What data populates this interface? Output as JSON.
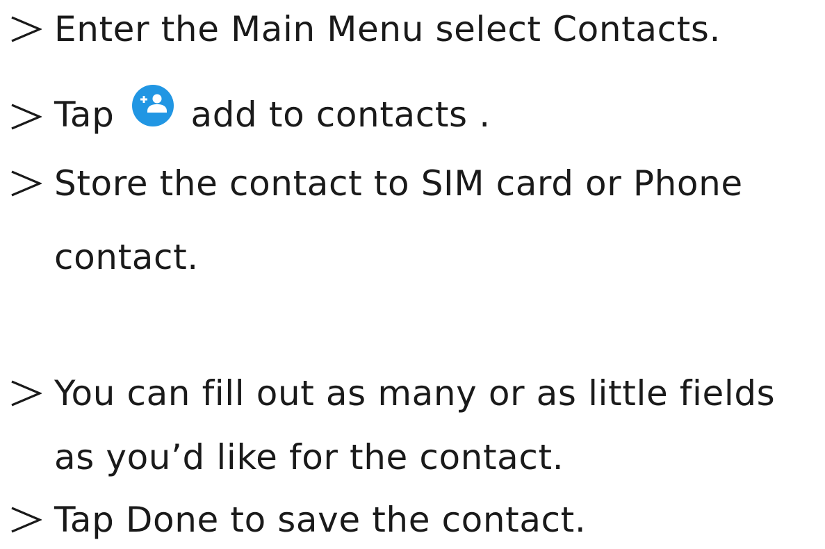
{
  "bullets": [
    {
      "text": "Enter the Main Menu select Contacts."
    },
    {
      "before": "Tap",
      "icon": "add-contact-icon",
      "after": "add to contacts ."
    },
    {
      "text": "Store the contact to SIM card or Phone"
    },
    {
      "text": "contact."
    },
    {
      "text": "You can fill out as many or as little fields"
    },
    {
      "text": "as you’d like for the contact."
    },
    {
      "text": "Tap Done to save the contact."
    }
  ],
  "colors": {
    "text": "#1a1a1a",
    "icon_fill": "#2196e3",
    "icon_glyph": "#ffffff"
  },
  "icons": {
    "bullet": "arrowhead-bullet-icon",
    "add_contact": "add-contact-icon"
  }
}
